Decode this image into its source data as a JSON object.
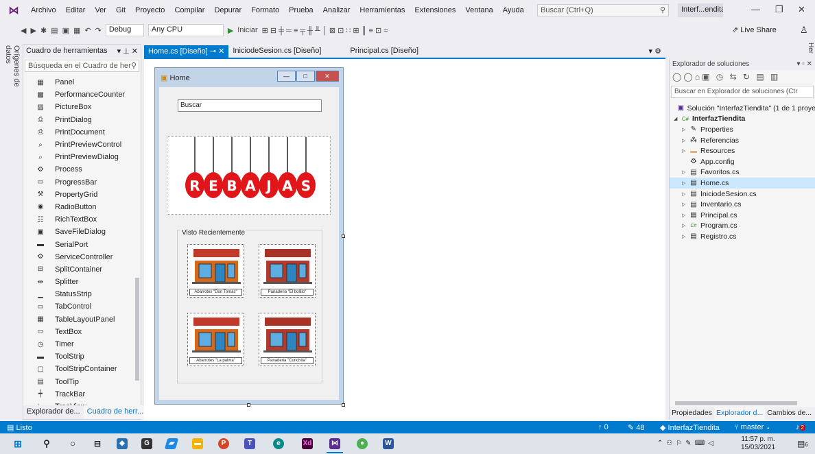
{
  "menu": [
    "Archivo",
    "Editar",
    "Ver",
    "Git",
    "Proyecto",
    "Compilar",
    "Depurar",
    "Formato",
    "Prueba",
    "Analizar",
    "Herramientas",
    "Extensiones",
    "Ventana",
    "Ayuda"
  ],
  "search_placeholder": "Buscar (Ctrl+Q)",
  "solution_short": "Interf...endita",
  "toolbar": {
    "config": "Debug",
    "platform": "Any CPU",
    "start": "Iniciar",
    "liveshare": "Live Share"
  },
  "left_vtab": "Orígenes de datos",
  "toolbox": {
    "title": "Cuadro de herramientas",
    "search": "Búsqueda en el Cuadro de her",
    "items": [
      {
        "icon": "panel-icon",
        "label": "Panel"
      },
      {
        "icon": "performance-counter-icon",
        "label": "PerformanceCounter"
      },
      {
        "icon": "picturebox-icon",
        "label": "PictureBox"
      },
      {
        "icon": "print-dialog-icon",
        "label": "PrintDialog"
      },
      {
        "icon": "print-document-icon",
        "label": "PrintDocument"
      },
      {
        "icon": "print-preview-control-icon",
        "label": "PrintPreviewControl"
      },
      {
        "icon": "print-preview-dialog-icon",
        "label": "PrintPreviewDialog"
      },
      {
        "icon": "process-icon",
        "label": "Process"
      },
      {
        "icon": "progressbar-icon",
        "label": "ProgressBar"
      },
      {
        "icon": "propertygrid-icon",
        "label": "PropertyGrid"
      },
      {
        "icon": "radiobutton-icon",
        "label": "RadioButton"
      },
      {
        "icon": "richtextbox-icon",
        "label": "RichTextBox"
      },
      {
        "icon": "savefiledialog-icon",
        "label": "SaveFileDialog"
      },
      {
        "icon": "serialport-icon",
        "label": "SerialPort"
      },
      {
        "icon": "servicecontroller-icon",
        "label": "ServiceController"
      },
      {
        "icon": "splitcontainer-icon",
        "label": "SplitContainer"
      },
      {
        "icon": "splitter-icon",
        "label": "Splitter"
      },
      {
        "icon": "statusstrip-icon",
        "label": "StatusStrip"
      },
      {
        "icon": "tabcontrol-icon",
        "label": "TabControl"
      },
      {
        "icon": "tablelayoutpanel-icon",
        "label": "TableLayoutPanel"
      },
      {
        "icon": "textbox-icon",
        "label": "TextBox"
      },
      {
        "icon": "timer-icon",
        "label": "Timer"
      },
      {
        "icon": "toolstrip-icon",
        "label": "ToolStrip"
      },
      {
        "icon": "toolstripcontainer-icon",
        "label": "ToolStripContainer"
      },
      {
        "icon": "tooltip-icon",
        "label": "ToolTip"
      },
      {
        "icon": "trackbar-icon",
        "label": "TrackBar"
      },
      {
        "icon": "treeview-icon",
        "label": "TreeView"
      }
    ],
    "bottom_tabs": [
      "Explorador de...",
      "Cuadro de herr..."
    ]
  },
  "doc_tabs": [
    "Home.cs [Diseño]",
    "IniciodeSesion.cs [Diseño]",
    "Principal.cs [Diseño]"
  ],
  "form": {
    "title": "Home",
    "search_value": "Buscar",
    "banner_letters": [
      "R",
      "E",
      "B",
      "A",
      "J",
      "A",
      "S"
    ],
    "group_label": "Visto Recientemente",
    "shops": [
      {
        "caption": "Abarrotes \"Don Tomas\"",
        "awning": "#c0392b",
        "body": "#d2691e"
      },
      {
        "caption": "Panaderia \"El bolillo\"",
        "awning": "#a93226",
        "body": "#b03a2e"
      },
      {
        "caption": "Abarrotes \"La palma\"",
        "awning": "#c0392b",
        "body": "#d2691e"
      },
      {
        "caption": "Panaderia \"Conchita\"",
        "awning": "#a93226",
        "body": "#b03a2e"
      }
    ]
  },
  "solution_explorer": {
    "title": "Explorador de soluciones",
    "search": "Buscar en Explorador de soluciones (Ctr",
    "solution": "Solución \"InterfazTiendita\" (1 de 1 proye",
    "project": "InterfazTiendita",
    "nodes": [
      {
        "icon": "wrench-icon",
        "label": "Properties",
        "arrow": true
      },
      {
        "icon": "references-icon",
        "label": "Referencias",
        "arrow": true
      },
      {
        "icon": "folder-icon",
        "label": "Resources",
        "arrow": true
      },
      {
        "icon": "config-icon",
        "label": "App.config",
        "arrow": false
      },
      {
        "icon": "form-icon",
        "label": "Favoritos.cs",
        "arrow": true
      },
      {
        "icon": "form-icon",
        "label": "Home.cs",
        "arrow": true,
        "selected": true
      },
      {
        "icon": "form-icon",
        "label": "IniciodeSesion.cs",
        "arrow": true
      },
      {
        "icon": "form-icon",
        "label": "Inventario.cs",
        "arrow": true
      },
      {
        "icon": "form-icon",
        "label": "Principal.cs",
        "arrow": true
      },
      {
        "icon": "csharp-icon",
        "label": "Program.cs",
        "arrow": true
      },
      {
        "icon": "form-icon",
        "label": "Registro.cs",
        "arrow": true
      }
    ],
    "bottom_tabs": [
      "Propiedades",
      "Explorador d...",
      "Cambios de..."
    ]
  },
  "right_vtab": "Her",
  "status": {
    "ready": "Listo",
    "up": "0",
    "edits": "48",
    "repo": "InterfazTiendita",
    "branch": "master",
    "notif": "2"
  },
  "taskbar": {
    "time": "11:57 p. m.",
    "date": "15/03/2021",
    "badge": "6"
  }
}
